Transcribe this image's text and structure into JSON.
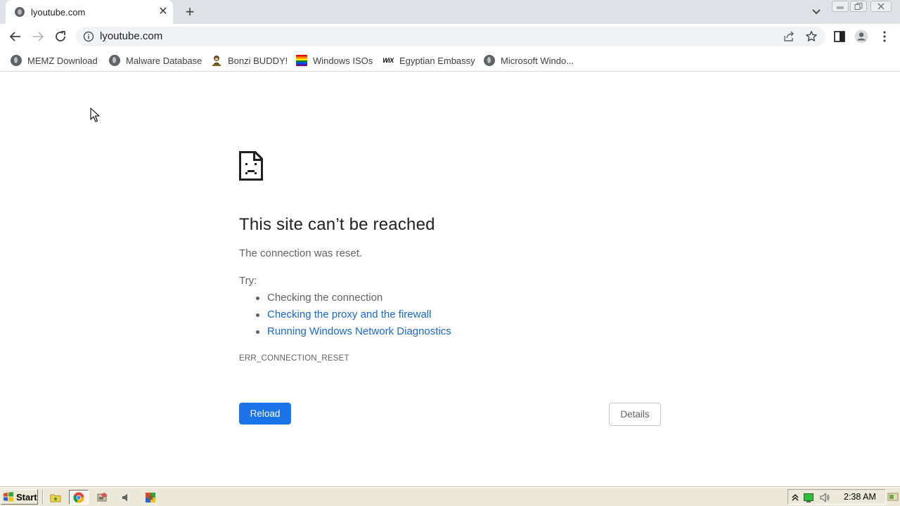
{
  "browser": {
    "tab": {
      "title": "lyoutube.com",
      "favicon": "globe-icon",
      "close_glyph": "✕"
    },
    "new_tab_glyph": "+",
    "omnibox": {
      "url": "lyoutube.com"
    }
  },
  "bookmarks": [
    {
      "label": "MEMZ Download",
      "icon": "globe-icon"
    },
    {
      "label": "Malware Database",
      "icon": "globe-icon"
    },
    {
      "label": "Bonzi BUDDY!",
      "icon": "bonzi-buddy-icon"
    },
    {
      "label": "Windows ISOs",
      "icon": "rainbow-flag-icon"
    },
    {
      "label": "Egyptian Embassy",
      "icon": "wix-icon",
      "icon_text": "WiX"
    },
    {
      "label": "Microsoft Windo...",
      "icon": "globe-icon"
    }
  ],
  "error": {
    "heading": "This site can’t be reached",
    "description": "The connection was reset.",
    "try_label": "Try:",
    "suggestions": [
      {
        "text": "Checking the connection",
        "link": false
      },
      {
        "text": "Checking the proxy and the firewall",
        "link": true
      },
      {
        "text": "Running Windows Network Diagnostics",
        "link": true
      }
    ],
    "code": "ERR_CONNECTION_RESET",
    "reload_label": "Reload",
    "details_label": "Details"
  },
  "taskbar": {
    "start_label": "Start",
    "clock": "2:38 AM"
  },
  "colors": {
    "accent": "#1a73e8",
    "link": "#1967d2",
    "tabstrip": "#dee1e6",
    "taskbar": "#ece9d8"
  }
}
